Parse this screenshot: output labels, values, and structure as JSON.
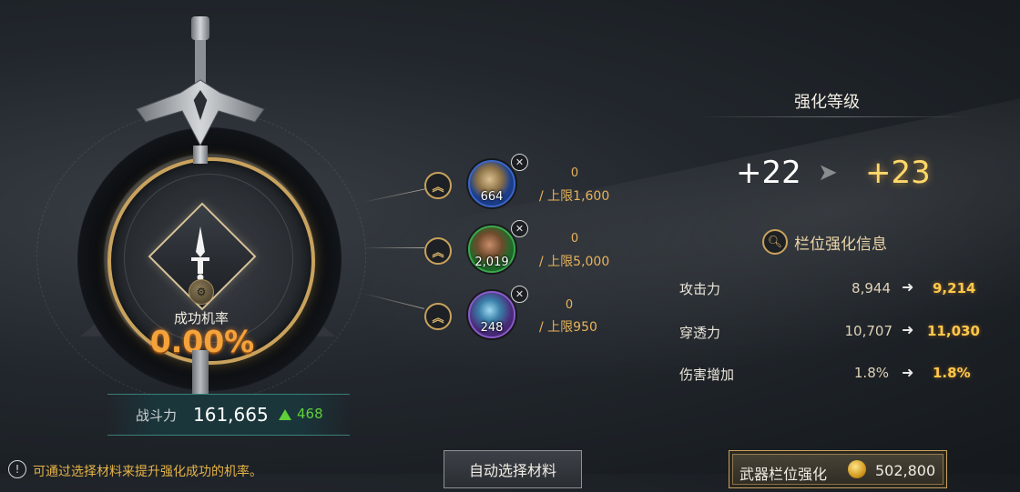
{
  "emblem": {
    "success_rate_label": "成功机率",
    "success_rate_value": "0.00%"
  },
  "combat_power": {
    "label": "战斗力",
    "value": "161,665",
    "delta": "468"
  },
  "materials": [
    {
      "count": "664",
      "current": "0",
      "limit": "/ 上限1,600",
      "rarity_color": "#3a66c8"
    },
    {
      "count": "2,019",
      "current": "0",
      "limit": "/ 上限5,000",
      "rarity_color": "#3aa84a"
    },
    {
      "count": "248",
      "current": "0",
      "limit": "/ 上限950",
      "rarity_color": "#8a5ac8"
    }
  ],
  "enhance_level": {
    "title": "强化等级",
    "from": "+22",
    "to": "+23"
  },
  "slot_info": {
    "label": "栏位强化信息",
    "stats": [
      {
        "name": "攻击力",
        "old": "8,944",
        "new": "9,214"
      },
      {
        "name": "穿透力",
        "old": "10,707",
        "new": "11,030"
      },
      {
        "name": "伤害增加",
        "old": "1.8%",
        "new": "1.8%"
      }
    ]
  },
  "tip": {
    "text": "可通过选择材料来提升强化成功的机率。"
  },
  "buttons": {
    "auto_select": "自动选择材料",
    "weapon_slot_enhance": "武器栏位强化",
    "enhance_cost": "502,800"
  },
  "colors": {
    "accent_gold": "#c9a25d",
    "rate_orange": "#f4a23a",
    "upgrade_yellow": "#ffc94a",
    "positive_green": "#5fcf3a"
  }
}
